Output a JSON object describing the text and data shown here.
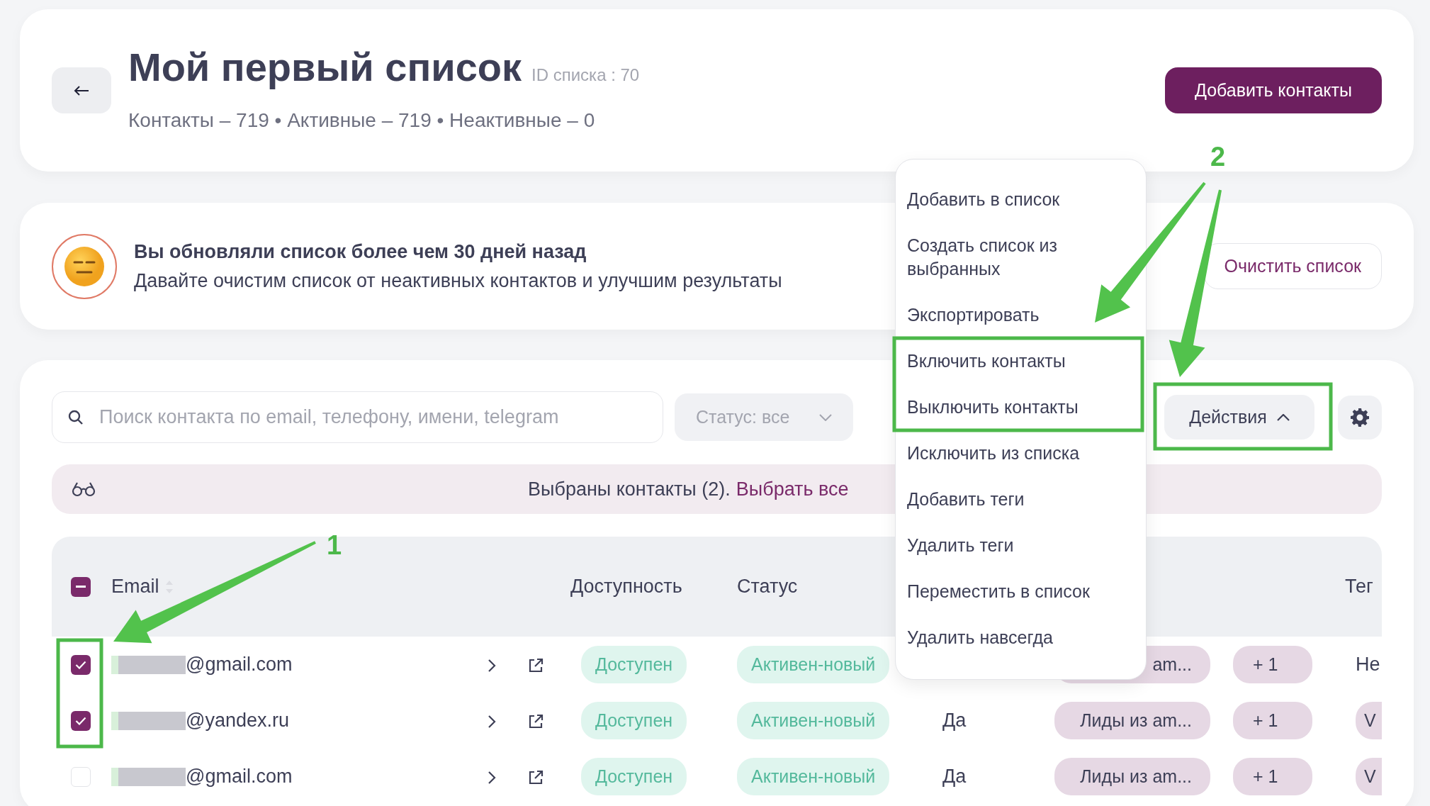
{
  "header": {
    "title": "Мой первый список",
    "list_id": "ID списка : 70",
    "stats": "Контакты – 719 • Активные – 719 • Неактивные – 0",
    "add_button": "Добавить контакты"
  },
  "notice": {
    "title": "Вы обновляли список более чем 30 дней назад",
    "text": "Давайте очистим список от неактивных контактов и улучшим результаты",
    "button": "Очистить список"
  },
  "toolbar": {
    "search": {
      "placeholder": "Поиск контакта по email, телефону, имени, telegram"
    },
    "status_filter": "Статус: все",
    "actions_button": "Действия",
    "actions_expanded": true
  },
  "selection_bar": {
    "text": "Выбраны контакты (2).",
    "link": "Выбрать все"
  },
  "actions_menu": [
    "Добавить в список",
    "Создать список из выбранных",
    "Экспортировать",
    "Включить контакты",
    "Выключить контакты",
    "Исключить из списка",
    "Добавить теги",
    "Удалить теги",
    "Переместить в список",
    "Удалить навсегда"
  ],
  "table": {
    "select_all": {
      "indeterminate": true
    },
    "columns": [
      "Email",
      "Доступность",
      "Статус",
      "Тег"
    ],
    "rows": [
      {
        "checked": true,
        "email": "@gmail.com",
        "availability": "Доступен",
        "status": "Активен-новый",
        "tag": "am...",
        "extra": "+ 1",
        "last_cell": {
          "kind": "text",
          "text": "Не"
        }
      },
      {
        "checked": true,
        "email": "@yandex.ru",
        "availability": "Доступен",
        "status": "Активен-новый",
        "column_5": "Да",
        "tag": "Лиды из am...",
        "extra": "+ 1",
        "last_cell": {
          "kind": "tag",
          "text": "V"
        }
      },
      {
        "checked": false,
        "email": "@gmail.com",
        "availability": "Доступен",
        "status": "Активен-новый",
        "column_5": "Да",
        "tag": "Лиды из am...",
        "extra": "+ 1",
        "last_cell": {
          "kind": "tag",
          "text": "V"
        }
      }
    ]
  },
  "annotations": [
    {
      "label": "2"
    },
    {
      "label": "1"
    }
  ]
}
